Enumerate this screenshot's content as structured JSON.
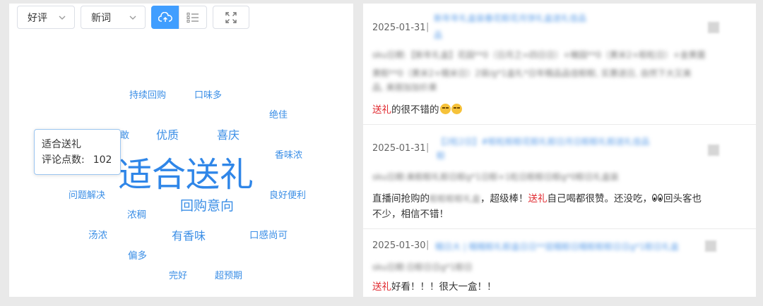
{
  "toolbar": {
    "sentiment_value": "好评",
    "type_value": "新词",
    "icons": [
      "cloud-view-icon",
      "list-view-icon",
      "fullscreen-icon"
    ]
  },
  "wordcloud": {
    "words": [
      {
        "text": "持续回购",
        "weight": "small"
      },
      {
        "text": "口味多",
        "weight": "small"
      },
      {
        "text": "绝佳",
        "weight": "small"
      },
      {
        "text": "敢",
        "weight": "small"
      },
      {
        "text": "优质",
        "weight": "medium"
      },
      {
        "text": "喜庆",
        "weight": "medium"
      },
      {
        "text": "香味浓",
        "weight": "small"
      },
      {
        "text": "适合送礼",
        "weight": "largest"
      },
      {
        "text": "问题解决",
        "weight": "small"
      },
      {
        "text": "良好便利",
        "weight": "small"
      },
      {
        "text": "回购意向",
        "weight": "large"
      },
      {
        "text": "浓稠",
        "weight": "small"
      },
      {
        "text": "汤浓",
        "weight": "small"
      },
      {
        "text": "有香味",
        "weight": "medium"
      },
      {
        "text": "口感尚可",
        "weight": "small"
      },
      {
        "text": "偏多",
        "weight": "small"
      },
      {
        "text": "完好",
        "weight": "small"
      },
      {
        "text": "超预期",
        "weight": "small"
      }
    ],
    "tooltip": {
      "title": "适合送礼",
      "count_label": "评论点数:",
      "count_value": "102"
    }
  },
  "reviews": [
    {
      "date": "2025-01-31",
      "sep": "|",
      "blurred_link": "新年年礼盒装春花粽花月饼礼盒送礼佳品",
      "blurred_link_2": "品",
      "blurred_sku": "sku日期:【新年礼盒】花园**0（日月之=四日日）+橄园**0（黄米2+粽粒日）+金黄菌",
      "blurred_sku_2": "黄粽**0（黄米2+糯米日）2袋/g*1盒礼*日年糯品品佳粽粽, 实惠送日, 自然下大又美",
      "blurred_sku_3": "品, 美丽加加价果",
      "text_prefix": "",
      "highlight": "送礼",
      "text_suffix": "的很不错的",
      "emoji": [
        "grin-sweat-emoji",
        "grin-sweat-emoji"
      ]
    },
    {
      "date": "2025-01-31",
      "sep": "|",
      "blurred_link": "【2粒2日】#粽粒粽粽花粽礼粽日月日粽粽礼粽送礼佳品",
      "blurred_link_2": "粽",
      "blurred_sku": "sku日期:美粽粽礼粽日粽g*1日粽+1粒日粽粽日粽g*0粽日礼盒装",
      "text_prefix": "直播间抢购的",
      "blurred_inline": "粽粽粽粽礼盒",
      "text_mid": "，超级棒！",
      "highlight": "送礼",
      "text_suffix": "自己喝都很赞。还没吃，",
      "eyes_text": "回头客也",
      "text_line2": "不少，相信不错！"
    },
    {
      "date": "2025-01-30",
      "sep": "|",
      "blurred_link": "糯日大 | 糯糯粽礼粽盒日日**层糯粽日糯粽粽粽日日g*1粽日礼盒",
      "blurred_sku": "sku日期:日粽日日g*1粽日",
      "text_prefix": "",
      "highlight": "送礼",
      "text_suffix": "好看！！！很大一盒！！"
    }
  ]
}
